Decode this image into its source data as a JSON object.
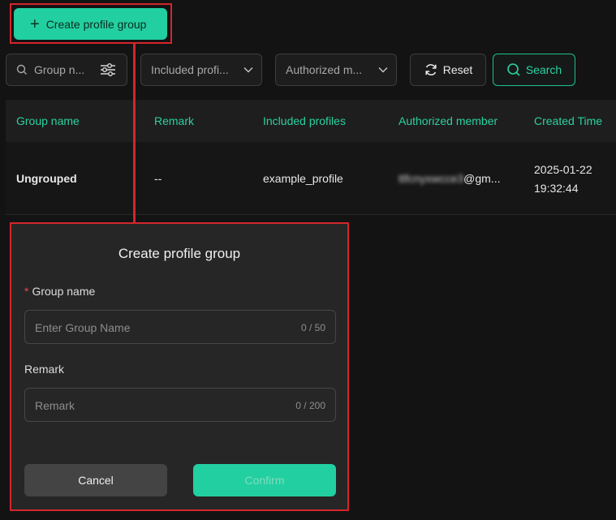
{
  "toolbar": {
    "create_label": "Create profile group"
  },
  "filters": {
    "group_name_placeholder": "Group n...",
    "included_profiles": "Included profi...",
    "authorized_member": "Authorized m...",
    "reset_label": "Reset",
    "search_label": "Search"
  },
  "table": {
    "headers": [
      "Group name",
      "Remark",
      "Included profiles",
      "Authorized member",
      "Created Time"
    ],
    "rows": [
      {
        "group_name": "Ungrouped",
        "remark": "--",
        "included_profiles": "example_profile",
        "member_hidden": "ttfcnyxwcce3",
        "member_visible": "@gm...",
        "created_date": "2025-01-22",
        "created_time": "19:32:44"
      }
    ]
  },
  "dialog": {
    "title": "Create profile group",
    "group_name_label": "Group name",
    "required_mark": "*",
    "group_name_placeholder": "Enter Group Name",
    "group_name_count": "0 / 50",
    "remark_label": "Remark",
    "remark_placeholder": "Remark",
    "remark_count": "0 / 200",
    "cancel_label": "Cancel",
    "confirm_label": "Confirm"
  },
  "colors": {
    "accent": "#22cfa0",
    "highlight": "#d3262b",
    "background": "#131313"
  }
}
